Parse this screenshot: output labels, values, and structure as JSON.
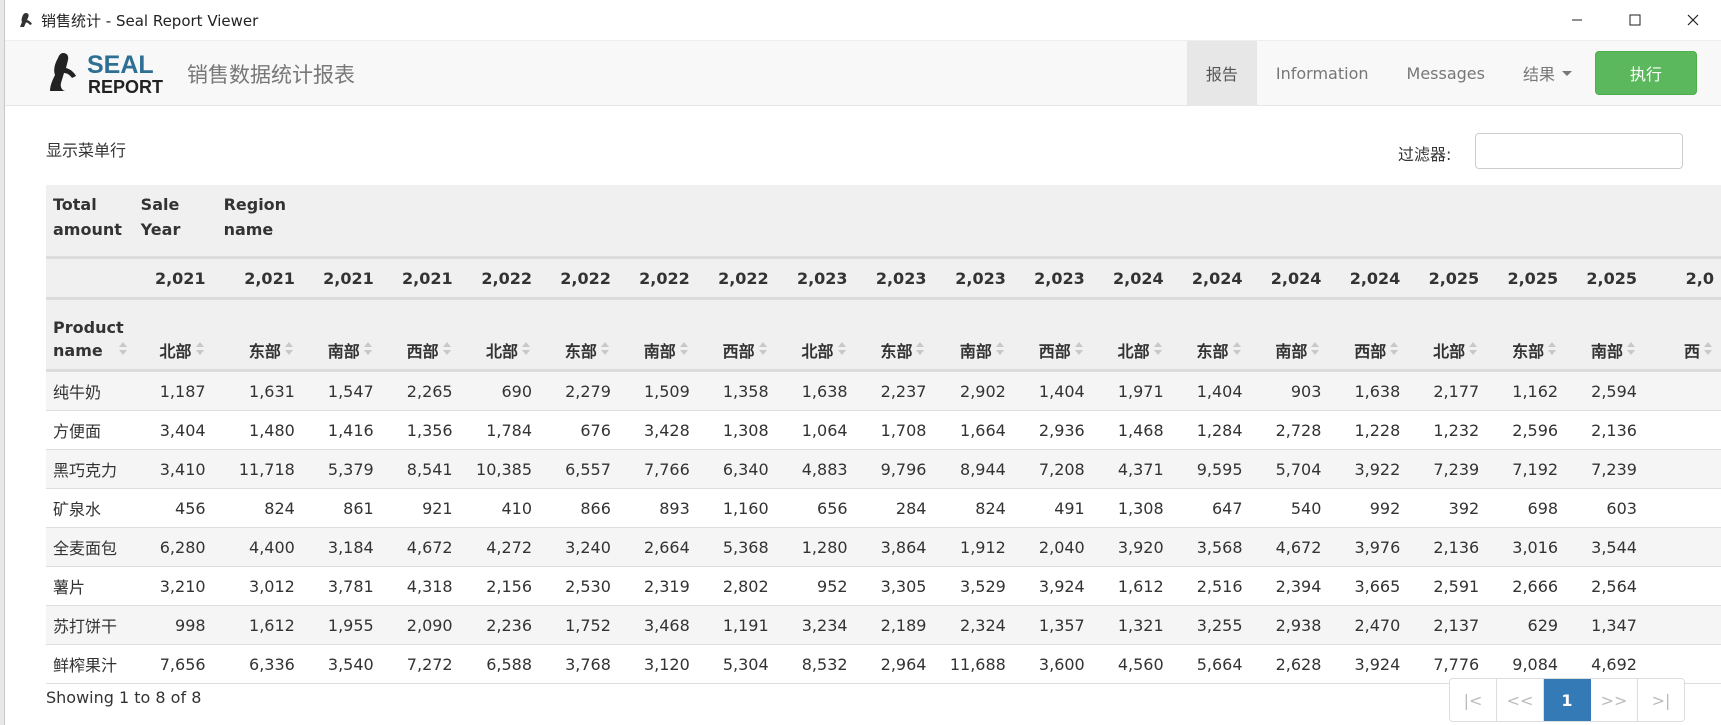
{
  "window": {
    "title": "销售统计 - Seal Report Viewer"
  },
  "navbar": {
    "logo_top": "SEAL",
    "logo_bottom": "REPORT",
    "report_title": "销售数据统计报表",
    "links": [
      {
        "label": "报告",
        "active": true
      },
      {
        "label": "Information",
        "active": false
      },
      {
        "label": "Messages",
        "active": false
      },
      {
        "label": "结果",
        "active": false,
        "dropdown": true
      }
    ],
    "execute_label": "执行"
  },
  "toolbar": {
    "menu_label": "显示菜单行",
    "filter_label": "过滤器:",
    "filter_value": ""
  },
  "table": {
    "corner_headers": [
      "Total amount",
      "Sale Year",
      "Region name"
    ],
    "row_header_label": "Product name",
    "years": [
      "2,021",
      "2,021",
      "2,021",
      "2,021",
      "2,022",
      "2,022",
      "2,022",
      "2,022",
      "2,023",
      "2,023",
      "2,023",
      "2,023",
      "2,024",
      "2,024",
      "2,024",
      "2,024",
      "2,025",
      "2,025",
      "2,025",
      "2,0"
    ],
    "regions": [
      "北部",
      "东部",
      "南部",
      "西部",
      "北部",
      "东部",
      "南部",
      "西部",
      "北部",
      "东部",
      "南部",
      "西部",
      "北部",
      "东部",
      "南部",
      "西部",
      "北部",
      "东部",
      "南部",
      "西"
    ],
    "rows": [
      {
        "product": "纯牛奶",
        "values": [
          "1,187",
          "1,631",
          "1,547",
          "2,265",
          "690",
          "2,279",
          "1,509",
          "1,358",
          "1,638",
          "2,237",
          "2,902",
          "1,404",
          "1,971",
          "1,404",
          "903",
          "1,638",
          "2,177",
          "1,162",
          "2,594",
          ""
        ]
      },
      {
        "product": "方便面",
        "values": [
          "3,404",
          "1,480",
          "1,416",
          "1,356",
          "1,784",
          "676",
          "3,428",
          "1,308",
          "1,064",
          "1,708",
          "1,664",
          "2,936",
          "1,468",
          "1,284",
          "2,728",
          "1,228",
          "1,232",
          "2,596",
          "2,136",
          ""
        ]
      },
      {
        "product": "黑巧克力",
        "values": [
          "3,410",
          "11,718",
          "5,379",
          "8,541",
          "10,385",
          "6,557",
          "7,766",
          "6,340",
          "4,883",
          "9,796",
          "8,944",
          "7,208",
          "4,371",
          "9,595",
          "5,704",
          "3,922",
          "7,239",
          "7,192",
          "7,239",
          ""
        ]
      },
      {
        "product": "矿泉水",
        "values": [
          "456",
          "824",
          "861",
          "921",
          "410",
          "866",
          "893",
          "1,160",
          "656",
          "284",
          "824",
          "491",
          "1,308",
          "647",
          "540",
          "992",
          "392",
          "698",
          "603",
          ""
        ]
      },
      {
        "product": "全麦面包",
        "values": [
          "6,280",
          "4,400",
          "3,184",
          "4,672",
          "4,272",
          "3,240",
          "2,664",
          "5,368",
          "1,280",
          "3,864",
          "1,912",
          "2,040",
          "3,920",
          "3,568",
          "4,672",
          "3,976",
          "2,136",
          "3,016",
          "3,544",
          ""
        ]
      },
      {
        "product": "薯片",
        "values": [
          "3,210",
          "3,012",
          "3,781",
          "4,318",
          "2,156",
          "2,530",
          "2,319",
          "2,802",
          "952",
          "3,305",
          "3,529",
          "3,924",
          "1,612",
          "2,516",
          "2,394",
          "3,665",
          "2,591",
          "2,666",
          "2,564",
          ""
        ]
      },
      {
        "product": "苏打饼干",
        "values": [
          "998",
          "1,612",
          "1,955",
          "2,090",
          "2,236",
          "1,752",
          "3,468",
          "1,191",
          "3,234",
          "2,189",
          "2,324",
          "1,357",
          "1,321",
          "3,255",
          "2,938",
          "2,470",
          "2,137",
          "629",
          "1,347",
          ""
        ]
      },
      {
        "product": "鲜榨果汁",
        "values": [
          "7,656",
          "6,336",
          "3,540",
          "7,272",
          "6,588",
          "3,768",
          "3,120",
          "5,304",
          "8,532",
          "2,964",
          "11,688",
          "3,600",
          "4,560",
          "5,664",
          "2,628",
          "3,924",
          "7,776",
          "9,084",
          "4,692",
          ""
        ]
      }
    ]
  },
  "footer": {
    "info": "Showing 1 to 8 of 8",
    "pager": [
      "|<",
      "<<",
      "1",
      ">>",
      ">|"
    ],
    "current_page": "1"
  },
  "colors": {
    "execute_green": "#5cb85c",
    "pager_active": "#337ab7",
    "logo_blue": "#2e6f94"
  }
}
